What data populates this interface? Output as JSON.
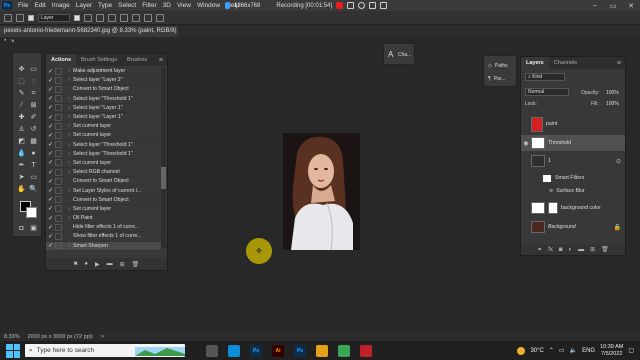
{
  "menubar": {
    "logo": "Ps",
    "items": [
      "File",
      "Edit",
      "Image",
      "Layer",
      "Type",
      "Select",
      "Filter",
      "3D",
      "View",
      "Window",
      "Help"
    ]
  },
  "recording": {
    "resolution": "1366x768",
    "status": "Recording [00:01:54]"
  },
  "options": {
    "layer_select": "Layer",
    "show_transform": "Show Transform Controls"
  },
  "document": {
    "tab_title": "pexels-antonio-friedemann-5682340.jpg @ 8.33% (paint, RGB/8) *",
    "close": "×"
  },
  "actions_panel": {
    "tabs": [
      "Actions",
      "Brush Settings",
      "Brushes"
    ],
    "items": [
      {
        "label": "Make adjustment layer",
        "expand": true
      },
      {
        "label": "Select layer \"Layer 2\"",
        "expand": true
      },
      {
        "label": "Convert to Smart Object",
        "expand": false
      },
      {
        "label": "Select layer \"Threshold 1\"",
        "expand": true
      },
      {
        "label": "Select layer \"Layer 1\"",
        "expand": true
      },
      {
        "label": "Select layer \"Layer 1\"",
        "expand": true
      },
      {
        "label": "Set current layer",
        "expand": true
      },
      {
        "label": "Set current layer",
        "expand": true
      },
      {
        "label": "Select layer \"Threshold 1\"",
        "expand": true
      },
      {
        "label": "Select layer \"Threshold 1\"",
        "expand": true
      },
      {
        "label": "Set current layer",
        "expand": true
      },
      {
        "label": "Select RGB channel",
        "expand": true
      },
      {
        "label": "Convert to Smart Object",
        "expand": false
      },
      {
        "label": "Set Layer Styles of current l...",
        "expand": true
      },
      {
        "label": "Convert to Smart Object",
        "expand": false
      },
      {
        "label": "Set current layer",
        "expand": true
      },
      {
        "label": "Oil Paint",
        "expand": true
      },
      {
        "label": "Hide filter effects 1 of curre...",
        "expand": false
      },
      {
        "label": "Show filter effects 1 of curre...",
        "expand": false
      },
      {
        "label": "Smart Sharpen",
        "expand": true
      }
    ],
    "bottom_icons": [
      "stop-icon",
      "record-icon",
      "play-icon",
      "folder-icon",
      "new-icon",
      "trash-icon"
    ]
  },
  "char_panel": {
    "label": "A",
    "sub": "Cha..."
  },
  "paths_panel": {
    "items": [
      "Paths",
      "Par..."
    ]
  },
  "layers_panel": {
    "tabs": [
      "Layers",
      "Channels"
    ],
    "kind": "Kind",
    "blend_mode": "Normal",
    "opacity_label": "Opacity:",
    "opacity": "100%",
    "lock_label": "Lock:",
    "fill_label": "Fill:",
    "fill": "100%",
    "layers": [
      {
        "name": "paint",
        "visible": false
      },
      {
        "name": "Threshold",
        "visible": true
      },
      {
        "name": "1",
        "visible": false
      },
      {
        "name": "Smart Filters",
        "visible": false
      },
      {
        "name": "Surface Blur",
        "visible": false
      },
      {
        "name": "background color",
        "visible": false
      },
      {
        "name": "Background",
        "visible": false
      }
    ],
    "footer_icons": [
      "link-icon",
      "fx",
      "mask-icon",
      "adjust-icon",
      "folder-icon",
      "new-icon",
      "trash-icon"
    ]
  },
  "status": {
    "zoom": "8.33%",
    "size": "2000 px x 3000 px (72 ppi)",
    "arrow": ">"
  },
  "taskbar": {
    "search_placeholder": "Type here to search",
    "weather": "30°C",
    "lang": "ENG",
    "time": "10:39 AM",
    "date": "7/5/2022",
    "apps": [
      {
        "name": "task-view",
        "label": "",
        "color": "#555"
      },
      {
        "name": "edge",
        "label": "",
        "color": "#0d8ed8"
      },
      {
        "name": "photoshop",
        "label": "Ps",
        "color": "#0c2d4d"
      },
      {
        "name": "illustrator",
        "label": "Ai",
        "color": "#330000"
      },
      {
        "name": "photoshop-2",
        "label": "Ps",
        "color": "#0c2d4d"
      },
      {
        "name": "files",
        "label": "",
        "color": "#e3a21a"
      },
      {
        "name": "chrome",
        "label": "",
        "color": "#3aa757"
      },
      {
        "name": "record",
        "label": "",
        "color": "#c0202a"
      }
    ]
  },
  "colors": {
    "accent": "#31a8ff",
    "highlight": "#c8b400",
    "fg": "#000000",
    "bg": "#ffffff"
  }
}
